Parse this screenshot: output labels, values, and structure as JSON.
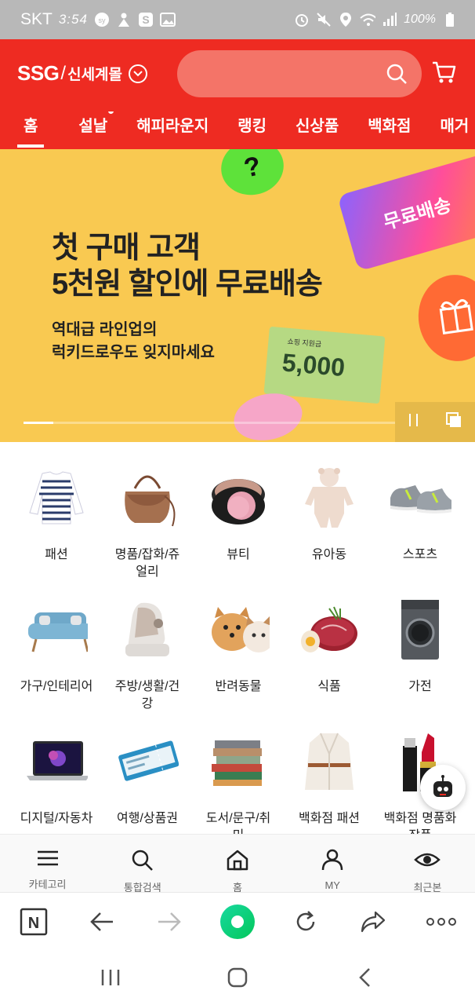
{
  "status_bar": {
    "carrier": "SKT",
    "time": "3:54",
    "battery": "100%"
  },
  "header": {
    "brand_main": "SSG",
    "brand_slash": "/",
    "brand_sub": "신세계몰",
    "nav_tabs": [
      {
        "label": "홈",
        "active": true
      },
      {
        "label": "설날",
        "dot": true
      },
      {
        "label": "해피라운지"
      },
      {
        "label": "랭킹"
      },
      {
        "label": "신상품"
      },
      {
        "label": "백화점"
      },
      {
        "label": "매거"
      }
    ]
  },
  "banner": {
    "headline_line1": "첫 구매 고객",
    "headline_line2": "5천원 할인에 무료배송",
    "sub_line1": "역대급 라인업의",
    "sub_line2": "럭키드로우도 잊지마세요",
    "badge_text": "무료배송",
    "ticket_small": "쇼핑 지원금",
    "ticket_amount": "5,000",
    "question_mark": "?",
    "progress_fraction": 0.08
  },
  "categories": [
    {
      "label": "패션",
      "icon": "striped-shirt-icon"
    },
    {
      "label": "명품/잡화/쥬얼리",
      "icon": "handbag-icon"
    },
    {
      "label": "뷰티",
      "icon": "cushion-compact-icon"
    },
    {
      "label": "유아동",
      "icon": "baby-romper-icon"
    },
    {
      "label": "스포츠",
      "icon": "sneakers-icon"
    },
    {
      "label": "가구/인테리어",
      "icon": "sofa-icon"
    },
    {
      "label": "주방/생활/건강",
      "icon": "massage-chair-icon"
    },
    {
      "label": "반려동물",
      "icon": "dog-cat-icon"
    },
    {
      "label": "식품",
      "icon": "steak-icon"
    },
    {
      "label": "가전",
      "icon": "washing-machine-icon"
    },
    {
      "label": "디지털/자동차",
      "icon": "laptop-icon"
    },
    {
      "label": "여행/상품권",
      "icon": "ticket-icon"
    },
    {
      "label": "도서/문구/취미",
      "icon": "books-icon"
    },
    {
      "label": "백화점 패션",
      "icon": "coat-icon"
    },
    {
      "label": "백화점 명품화장품",
      "icon": "lipstick-icon"
    }
  ],
  "app_nav": [
    {
      "label": "카테고리",
      "icon": "menu-icon"
    },
    {
      "label": "통합검색",
      "icon": "search-icon"
    },
    {
      "label": "홈",
      "icon": "home-icon"
    },
    {
      "label": "MY",
      "icon": "user-icon"
    },
    {
      "label": "최근본",
      "icon": "eye-icon"
    }
  ],
  "browser_toolbar": {
    "naver_label": "N"
  },
  "colors": {
    "brand_red": "#ee2b22",
    "banner_yellow": "#f9c951",
    "browser_green": "#03c75a"
  }
}
